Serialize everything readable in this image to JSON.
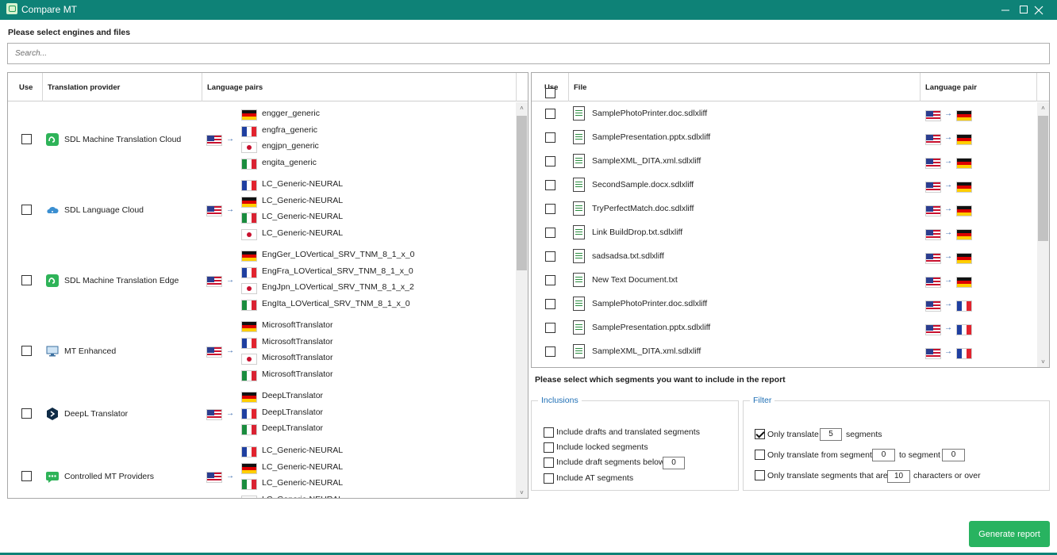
{
  "window": {
    "title": "Compare MT",
    "icon": "compare-mt-app-icon",
    "colors": {
      "titlebar": "#0e8277",
      "accent_button": "#28b360",
      "group_label": "#1e6fb5"
    }
  },
  "engines_section": {
    "heading": "Please select engines and files",
    "search_placeholder": "Search..."
  },
  "engines_table": {
    "headers": {
      "use": "Use",
      "provider": "Translation provider",
      "pairs": "Language pairs"
    },
    "providers": [
      {
        "name": "SDL Machine Translation Cloud",
        "icon": "sdl-mt-cloud-icon",
        "checked": false,
        "source_flag": "us",
        "pairs": [
          {
            "flag": "de",
            "label": "engger_generic"
          },
          {
            "flag": "fr",
            "label": "engfra_generic"
          },
          {
            "flag": "jp",
            "label": "engjpn_generic"
          },
          {
            "flag": "it",
            "label": "engita_generic"
          }
        ]
      },
      {
        "name": "SDL Language Cloud",
        "icon": "cloud-icon",
        "checked": false,
        "source_flag": "us",
        "pairs": [
          {
            "flag": "fr",
            "label": "LC_Generic-NEURAL"
          },
          {
            "flag": "de",
            "label": "LC_Generic-NEURAL"
          },
          {
            "flag": "it",
            "label": "LC_Generic-NEURAL"
          },
          {
            "flag": "jp",
            "label": "LC_Generic-NEURAL"
          }
        ]
      },
      {
        "name": "SDL Machine Translation Edge",
        "icon": "sdl-mt-edge-icon",
        "checked": false,
        "source_flag": "us",
        "pairs": [
          {
            "flag": "de",
            "label": "EngGer_LOVertical_SRV_TNM_8_1_x_0"
          },
          {
            "flag": "fr",
            "label": "EngFra_LOVertical_SRV_TNM_8_1_x_0"
          },
          {
            "flag": "jp",
            "label": "EngJpn_LOVertical_SRV_TNM_8_1_x_2"
          },
          {
            "flag": "it",
            "label": "EngIta_LOVertical_SRV_TNM_8_1_x_0"
          }
        ]
      },
      {
        "name": "MT Enhanced",
        "icon": "monitor-icon",
        "checked": false,
        "source_flag": "us",
        "pairs": [
          {
            "flag": "de",
            "label": "MicrosoftTranslator"
          },
          {
            "flag": "fr",
            "label": "MicrosoftTranslator"
          },
          {
            "flag": "jp",
            "label": "MicrosoftTranslator"
          },
          {
            "flag": "it",
            "label": "MicrosoftTranslator"
          }
        ]
      },
      {
        "name": "DeepL Translator",
        "icon": "deepl-icon",
        "checked": false,
        "source_flag": "us",
        "pairs": [
          {
            "flag": "de",
            "label": "DeepLTranslator"
          },
          {
            "flag": "fr",
            "label": "DeepLTranslator"
          },
          {
            "flag": "it",
            "label": "DeepLTranslator"
          }
        ]
      },
      {
        "name": "Controlled MT Providers",
        "icon": "chat-bubble-icon",
        "checked": false,
        "source_flag": "us",
        "pairs": [
          {
            "flag": "fr",
            "label": "LC_Generic-NEURAL"
          },
          {
            "flag": "de",
            "label": "LC_Generic-NEURAL"
          },
          {
            "flag": "it",
            "label": "LC_Generic-NEURAL"
          },
          {
            "flag": "jp",
            "label": "LC_Generic-NEURAL"
          }
        ]
      }
    ]
  },
  "files_table": {
    "headers": {
      "use": "Use",
      "file": "File",
      "pair": "Language pair"
    },
    "files": [
      {
        "name": "SamplePhotoPrinter.doc.sdlxliff",
        "source": "us",
        "target": "de",
        "checked": false
      },
      {
        "name": "SamplePresentation.pptx.sdlxliff",
        "source": "us",
        "target": "de",
        "checked": false
      },
      {
        "name": "SampleXML_DITA.xml.sdlxliff",
        "source": "us",
        "target": "de",
        "checked": false
      },
      {
        "name": "SecondSample.docx.sdlxliff",
        "source": "us",
        "target": "de",
        "checked": false
      },
      {
        "name": "TryPerfectMatch.doc.sdlxliff",
        "source": "us",
        "target": "de",
        "checked": false
      },
      {
        "name": "Link BuildDrop.txt.sdlxliff",
        "source": "us",
        "target": "de",
        "checked": false
      },
      {
        "name": "sadsadsa.txt.sdlxliff",
        "source": "us",
        "target": "de",
        "checked": false
      },
      {
        "name": "New Text Document.txt",
        "source": "us",
        "target": "de",
        "checked": false
      },
      {
        "name": "SamplePhotoPrinter.doc.sdlxliff",
        "source": "us",
        "target": "fr",
        "checked": false
      },
      {
        "name": "SamplePresentation.pptx.sdlxliff",
        "source": "us",
        "target": "fr",
        "checked": false
      },
      {
        "name": "SampleXML_DITA.xml.sdlxliff",
        "source": "us",
        "target": "fr",
        "checked": false
      }
    ]
  },
  "segments_section": {
    "heading": "Please select which segments you want to include in the report",
    "inclusions": {
      "label": "Inclusions",
      "options": [
        {
          "label": "Include drafts and translated segments",
          "checked": false
        },
        {
          "label": "Include locked segments",
          "checked": false
        },
        {
          "label": "Include draft segments below",
          "checked": false,
          "value": "0"
        },
        {
          "label": "Include AT segments",
          "checked": false
        }
      ]
    },
    "filter": {
      "label": "Filter",
      "only_translate": {
        "label": "Only translate",
        "value": "5",
        "suffix": "segments",
        "checked": true
      },
      "from_segment": {
        "label": "Only translate from segment",
        "from": "0",
        "to_label": "to segment",
        "to": "0",
        "checked": false
      },
      "chars": {
        "label": "Only translate segments that are",
        "value": "10",
        "suffix": "characters or over",
        "checked": false
      }
    }
  },
  "actions": {
    "generate_label": "Generate report"
  }
}
